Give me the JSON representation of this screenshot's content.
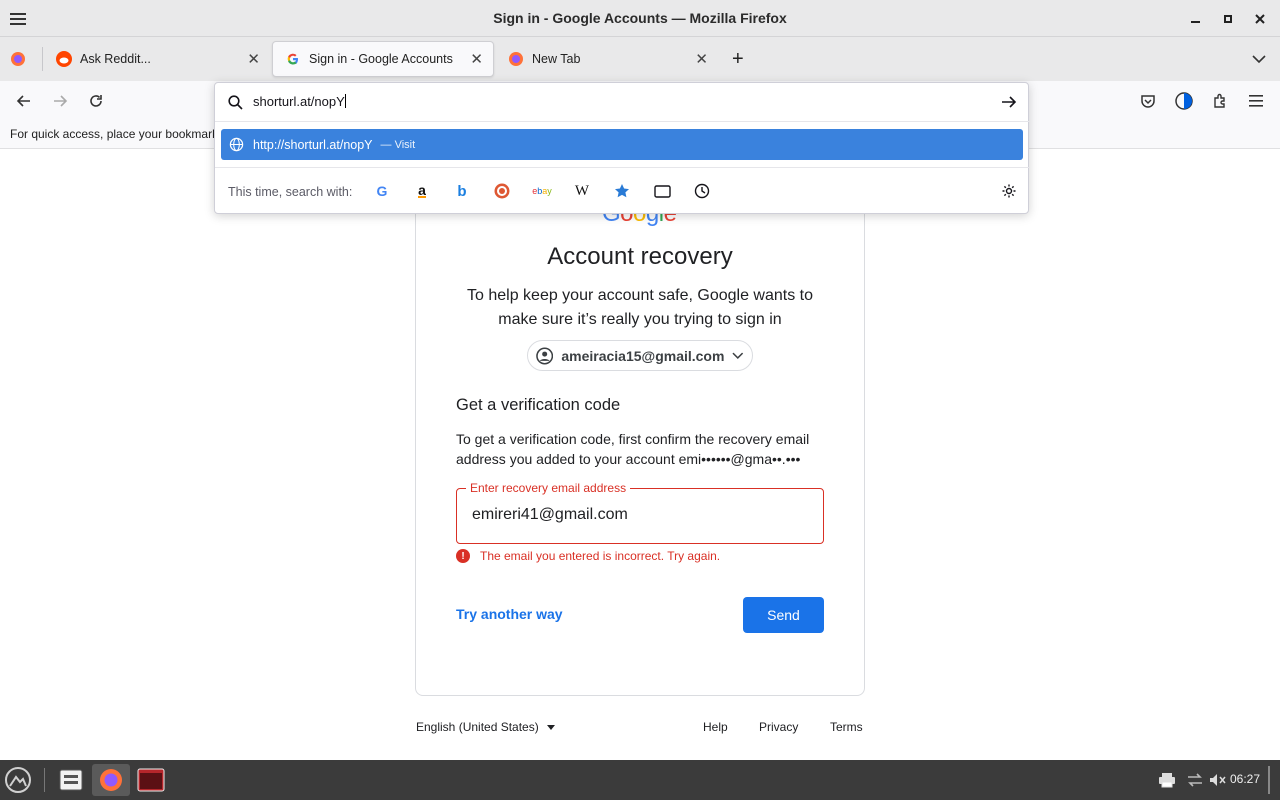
{
  "window": {
    "title": "Sign in - Google Accounts — Mozilla Firefox"
  },
  "tabs": [
    {
      "label": "Ask Reddit..."
    },
    {
      "label": "Sign in - Google Accounts"
    },
    {
      "label": "New Tab"
    }
  ],
  "bookmarks_bar": {
    "hint": "For quick access, place your bookmark"
  },
  "urlbar": {
    "value": "shorturl.at/nopY",
    "suggestion_url": "http://shorturl.at/nopY",
    "suggestion_action": "— Visit",
    "search_with_label": "This time, search with:",
    "engines": [
      "google-icon",
      "amazon-icon",
      "bing-icon",
      "duckduckgo-icon",
      "ebay-icon",
      "wikipedia-icon",
      "bookmarks-icon",
      "tabs-icon",
      "history-icon"
    ]
  },
  "page": {
    "logo": "Google",
    "heading": "Account recovery",
    "subtext": "To help keep your account safe, Google wants to make sure it’s really you trying to sign in",
    "account_email": "ameiracia15@gmail.com",
    "section_title": "Get a verification code",
    "section_text": "To get a verification code, first confirm the recovery email address you added to your account emi••••••@gma••.•••",
    "email_label": "Enter recovery email address",
    "email_value": "emireri41@gmail.com",
    "error_text": "The email you entered is incorrect. Try again.",
    "try_another": "Try another way",
    "send_label": "Send"
  },
  "footer": {
    "language": "English (United States)",
    "help": "Help",
    "privacy": "Privacy",
    "terms": "Terms"
  },
  "taskbar": {
    "clock": "06:27"
  },
  "colors": {
    "accent": "#1a73e8",
    "error": "#d93025",
    "suggestion_bg": "#3a82dd"
  }
}
